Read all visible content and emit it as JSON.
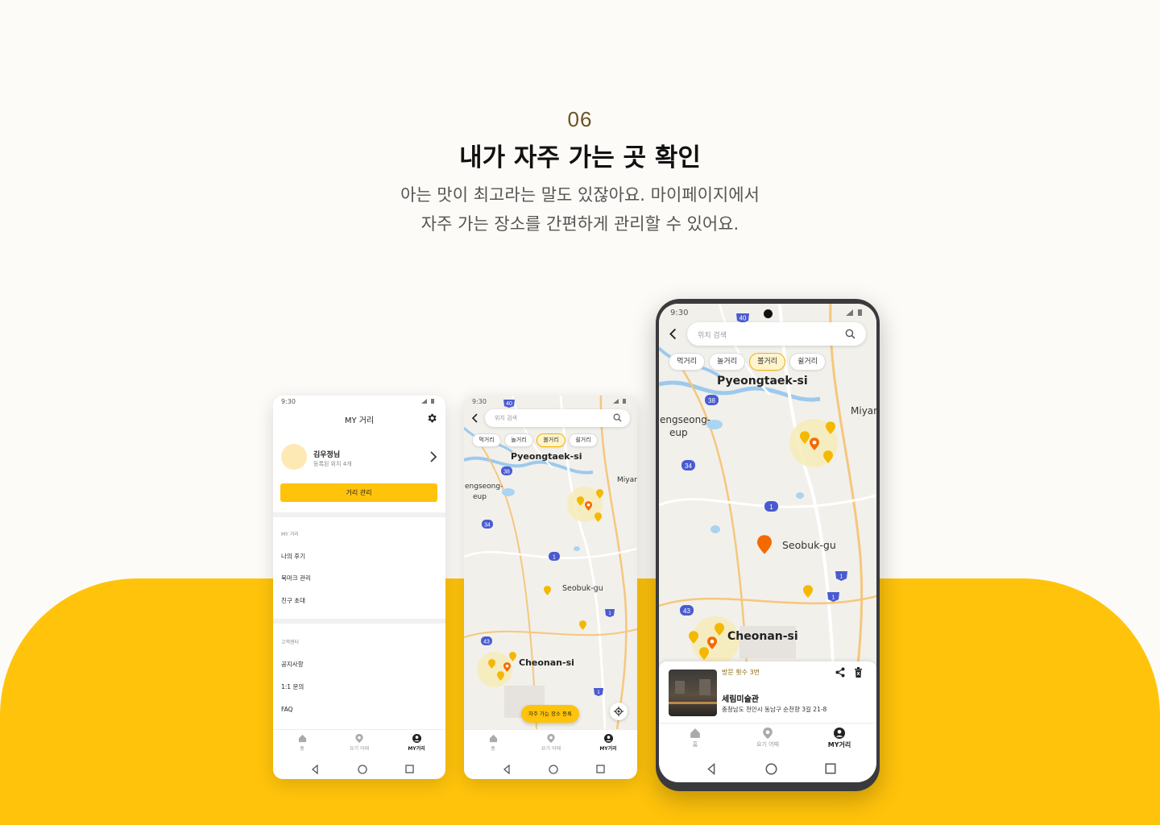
{
  "section": {
    "number": "06",
    "title": "내가 자주 가는 곳 확인",
    "desc_line1": "아는 맛이 최고라는 말도 있잖아요. 마이페이지에서",
    "desc_line2": "자주 가는 장소를 간편하게 관리할 수 있어요."
  },
  "status_time": "9:30",
  "phone_mypage": {
    "title": "MY 거리",
    "user_name": "김우정님",
    "user_sub": "등록된 위치 4개",
    "manage_button": "거리 관리",
    "section1_label": "MY 거리",
    "section1_items": [
      "나의 후기",
      "북마크 관리",
      "친구 초대"
    ],
    "section2_label": "고객센터",
    "section2_items": [
      "공지사항",
      "1:1 문의",
      "FAQ"
    ]
  },
  "nav": {
    "home": "홈",
    "near": "요기 어때",
    "my": "MY거리"
  },
  "map_screen": {
    "search_placeholder": "위치 검색",
    "chips": [
      "먹거리",
      "놀거리",
      "볼거리",
      "쉴거리"
    ],
    "selected_chip": "볼거리",
    "labels": {
      "pyeongtaek": "Pyeongtaek-si",
      "engseong": "engseong-",
      "eup": "eup",
      "miyan": "Miyan",
      "seobuk": "Seobuk-gu",
      "cheonan": "Cheonan-si"
    },
    "road_numbers": {
      "r40": "40",
      "r38": "38",
      "r34": "34",
      "r1": "1",
      "r43": "43"
    },
    "register_button": "자주 가는 장소 등록"
  },
  "place_card": {
    "visits": "방문 횟수 3번",
    "name": "세림미술관",
    "address": "충청남도 천안시 동남구 순천향 3길 21-8"
  },
  "colors": {
    "accent": "#ffc30b",
    "pin_yellow": "#f5b800",
    "pin_orange": "#f56a00",
    "road_blue": "#4a5bd1"
  }
}
